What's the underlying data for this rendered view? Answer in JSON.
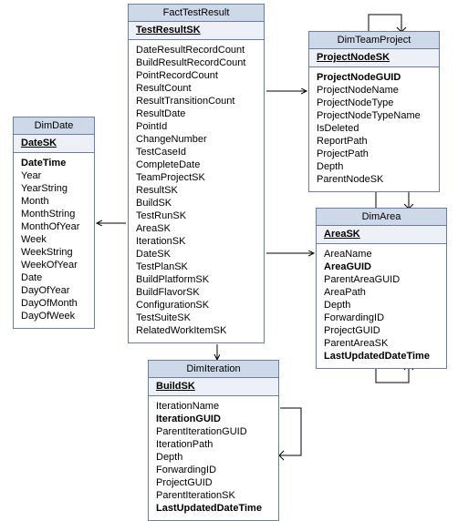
{
  "entities": {
    "date": {
      "title": "DimDate",
      "pk": "DateSK",
      "columns": [
        {
          "name": "DateTime",
          "bold": true
        },
        {
          "name": "Year"
        },
        {
          "name": "YearString"
        },
        {
          "name": "Month"
        },
        {
          "name": "MonthString"
        },
        {
          "name": "MonthOfYear"
        },
        {
          "name": "Week"
        },
        {
          "name": "WeekString"
        },
        {
          "name": "WeekOfYear"
        },
        {
          "name": "Date"
        },
        {
          "name": "DayOfYear"
        },
        {
          "name": "DayOfMonth"
        },
        {
          "name": "DayOfWeek"
        }
      ]
    },
    "fact": {
      "title": "FactTestResult",
      "pk": "TestResultSK",
      "columns": [
        {
          "name": "DateResultRecordCount"
        },
        {
          "name": "BuildResultRecordCount"
        },
        {
          "name": "PointRecordCount"
        },
        {
          "name": "ResultCount"
        },
        {
          "name": "ResultTransitionCount"
        },
        {
          "name": "ResultDate"
        },
        {
          "name": "PointId"
        },
        {
          "name": "ChangeNumber"
        },
        {
          "name": "TestCaseId"
        },
        {
          "name": "CompleteDate"
        },
        {
          "name": "TeamProjectSK"
        },
        {
          "name": "ResultSK"
        },
        {
          "name": "BuildSK"
        },
        {
          "name": "TestRunSK"
        },
        {
          "name": "AreaSK"
        },
        {
          "name": "IterationSK"
        },
        {
          "name": "DateSK"
        },
        {
          "name": "TestPlanSK"
        },
        {
          "name": "BuildPlatformSK"
        },
        {
          "name": "BuildFlavorSK"
        },
        {
          "name": "ConfigurationSK"
        },
        {
          "name": "TestSuiteSK"
        },
        {
          "name": "RelatedWorkItemSK"
        }
      ]
    },
    "team": {
      "title": "DimTeamProject",
      "pk": "ProjectNodeSK",
      "columns": [
        {
          "name": "ProjectNodeGUID",
          "bold": true
        },
        {
          "name": "ProjectNodeName"
        },
        {
          "name": "ProjectNodeType"
        },
        {
          "name": "ProjectNodeTypeName"
        },
        {
          "name": "IsDeleted"
        },
        {
          "name": "ReportPath"
        },
        {
          "name": "ProjectPath"
        },
        {
          "name": "Depth"
        },
        {
          "name": "ParentNodeSK"
        }
      ]
    },
    "area": {
      "title": "DimArea",
      "pk": "AreaSK",
      "columns": [
        {
          "name": "AreaName"
        },
        {
          "name": "AreaGUID",
          "bold": true
        },
        {
          "name": "ParentAreaGUID"
        },
        {
          "name": "AreaPath"
        },
        {
          "name": "Depth"
        },
        {
          "name": "ForwardingID"
        },
        {
          "name": "ProjectGUID"
        },
        {
          "name": "ParentAreaSK"
        },
        {
          "name": "LastUpdatedDateTime",
          "bold": true
        }
      ]
    },
    "iter": {
      "title": "DimIteration",
      "pk": "BuildSK",
      "columns": [
        {
          "name": "IterationName"
        },
        {
          "name": "IterationGUID",
          "bold": true
        },
        {
          "name": "ParentIterationGUID"
        },
        {
          "name": "IterationPath"
        },
        {
          "name": "Depth"
        },
        {
          "name": "ForwardingID"
        },
        {
          "name": "ProjectGUID"
        },
        {
          "name": "ParentIterationSK"
        },
        {
          "name": "LastUpdatedDateTime",
          "bold": true
        }
      ]
    }
  }
}
